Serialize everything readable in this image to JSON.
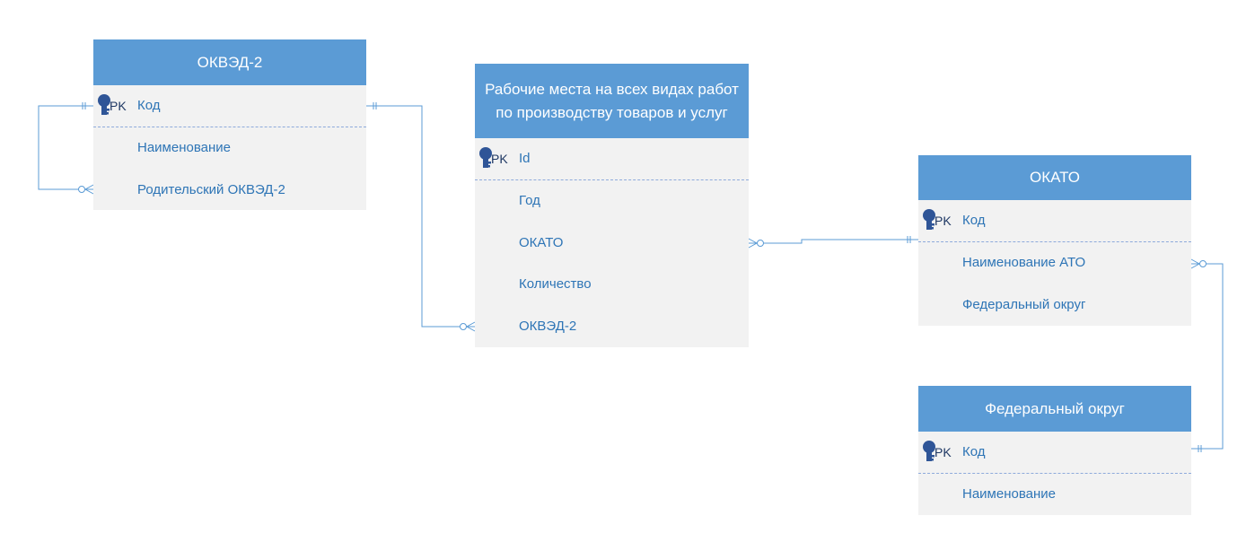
{
  "entities": {
    "okved2": {
      "title": "ОКВЭД-2",
      "pk_label": "PK",
      "fields": [
        "Код",
        "Наименование",
        "Родительский ОКВЭД-2"
      ]
    },
    "workplaces": {
      "title": "Рабочие места на всех видах работ по производству товаров и услуг",
      "pk_label": "PK",
      "fields": [
        "Id",
        "Год",
        "ОКАТО",
        "Количество",
        "ОКВЭД-2"
      ]
    },
    "okato": {
      "title": "ОКАТО",
      "pk_label": "PK",
      "fields": [
        "Код",
        "Наименование АТО",
        "Федеральный округ"
      ]
    },
    "federal_district": {
      "title": "Федеральный округ",
      "pk_label": "PK",
      "fields": [
        "Код",
        "Наименование"
      ]
    }
  },
  "relationships": [
    {
      "from": "okved2.Код",
      "to": "okved2.Родительский ОКВЭД-2",
      "cardinality": "one-to-zero-or-many"
    },
    {
      "from": "okved2.Код",
      "to": "workplaces.ОКВЭД-2",
      "cardinality": "one-to-zero-or-many"
    },
    {
      "from": "okato.Код",
      "to": "workplaces.ОКАТО",
      "cardinality": "one-to-zero-or-many"
    },
    {
      "from": "federal_district.Код",
      "to": "okato.Федеральный округ",
      "cardinality": "one-to-zero-or-many"
    }
  ],
  "colors": {
    "header": "#5b9bd5",
    "body": "#f2f2f2",
    "field_text": "#2e75b6",
    "pk_text": "#1f3864",
    "connector": "#5b9bd5"
  }
}
